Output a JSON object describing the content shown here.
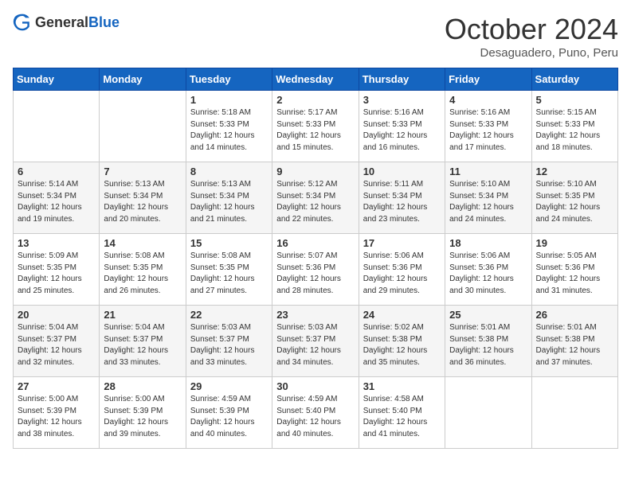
{
  "header": {
    "logo_general": "General",
    "logo_blue": "Blue",
    "month_title": "October 2024",
    "location": "Desaguadero, Puno, Peru"
  },
  "days_of_week": [
    "Sunday",
    "Monday",
    "Tuesday",
    "Wednesday",
    "Thursday",
    "Friday",
    "Saturday"
  ],
  "weeks": [
    [
      {
        "day": "",
        "info": ""
      },
      {
        "day": "",
        "info": ""
      },
      {
        "day": "1",
        "info": "Sunrise: 5:18 AM\nSunset: 5:33 PM\nDaylight: 12 hours\nand 14 minutes."
      },
      {
        "day": "2",
        "info": "Sunrise: 5:17 AM\nSunset: 5:33 PM\nDaylight: 12 hours\nand 15 minutes."
      },
      {
        "day": "3",
        "info": "Sunrise: 5:16 AM\nSunset: 5:33 PM\nDaylight: 12 hours\nand 16 minutes."
      },
      {
        "day": "4",
        "info": "Sunrise: 5:16 AM\nSunset: 5:33 PM\nDaylight: 12 hours\nand 17 minutes."
      },
      {
        "day": "5",
        "info": "Sunrise: 5:15 AM\nSunset: 5:33 PM\nDaylight: 12 hours\nand 18 minutes."
      }
    ],
    [
      {
        "day": "6",
        "info": "Sunrise: 5:14 AM\nSunset: 5:34 PM\nDaylight: 12 hours\nand 19 minutes."
      },
      {
        "day": "7",
        "info": "Sunrise: 5:13 AM\nSunset: 5:34 PM\nDaylight: 12 hours\nand 20 minutes."
      },
      {
        "day": "8",
        "info": "Sunrise: 5:13 AM\nSunset: 5:34 PM\nDaylight: 12 hours\nand 21 minutes."
      },
      {
        "day": "9",
        "info": "Sunrise: 5:12 AM\nSunset: 5:34 PM\nDaylight: 12 hours\nand 22 minutes."
      },
      {
        "day": "10",
        "info": "Sunrise: 5:11 AM\nSunset: 5:34 PM\nDaylight: 12 hours\nand 23 minutes."
      },
      {
        "day": "11",
        "info": "Sunrise: 5:10 AM\nSunset: 5:34 PM\nDaylight: 12 hours\nand 24 minutes."
      },
      {
        "day": "12",
        "info": "Sunrise: 5:10 AM\nSunset: 5:35 PM\nDaylight: 12 hours\nand 24 minutes."
      }
    ],
    [
      {
        "day": "13",
        "info": "Sunrise: 5:09 AM\nSunset: 5:35 PM\nDaylight: 12 hours\nand 25 minutes."
      },
      {
        "day": "14",
        "info": "Sunrise: 5:08 AM\nSunset: 5:35 PM\nDaylight: 12 hours\nand 26 minutes."
      },
      {
        "day": "15",
        "info": "Sunrise: 5:08 AM\nSunset: 5:35 PM\nDaylight: 12 hours\nand 27 minutes."
      },
      {
        "day": "16",
        "info": "Sunrise: 5:07 AM\nSunset: 5:36 PM\nDaylight: 12 hours\nand 28 minutes."
      },
      {
        "day": "17",
        "info": "Sunrise: 5:06 AM\nSunset: 5:36 PM\nDaylight: 12 hours\nand 29 minutes."
      },
      {
        "day": "18",
        "info": "Sunrise: 5:06 AM\nSunset: 5:36 PM\nDaylight: 12 hours\nand 30 minutes."
      },
      {
        "day": "19",
        "info": "Sunrise: 5:05 AM\nSunset: 5:36 PM\nDaylight: 12 hours\nand 31 minutes."
      }
    ],
    [
      {
        "day": "20",
        "info": "Sunrise: 5:04 AM\nSunset: 5:37 PM\nDaylight: 12 hours\nand 32 minutes."
      },
      {
        "day": "21",
        "info": "Sunrise: 5:04 AM\nSunset: 5:37 PM\nDaylight: 12 hours\nand 33 minutes."
      },
      {
        "day": "22",
        "info": "Sunrise: 5:03 AM\nSunset: 5:37 PM\nDaylight: 12 hours\nand 33 minutes."
      },
      {
        "day": "23",
        "info": "Sunrise: 5:03 AM\nSunset: 5:37 PM\nDaylight: 12 hours\nand 34 minutes."
      },
      {
        "day": "24",
        "info": "Sunrise: 5:02 AM\nSunset: 5:38 PM\nDaylight: 12 hours\nand 35 minutes."
      },
      {
        "day": "25",
        "info": "Sunrise: 5:01 AM\nSunset: 5:38 PM\nDaylight: 12 hours\nand 36 minutes."
      },
      {
        "day": "26",
        "info": "Sunrise: 5:01 AM\nSunset: 5:38 PM\nDaylight: 12 hours\nand 37 minutes."
      }
    ],
    [
      {
        "day": "27",
        "info": "Sunrise: 5:00 AM\nSunset: 5:39 PM\nDaylight: 12 hours\nand 38 minutes."
      },
      {
        "day": "28",
        "info": "Sunrise: 5:00 AM\nSunset: 5:39 PM\nDaylight: 12 hours\nand 39 minutes."
      },
      {
        "day": "29",
        "info": "Sunrise: 4:59 AM\nSunset: 5:39 PM\nDaylight: 12 hours\nand 40 minutes."
      },
      {
        "day": "30",
        "info": "Sunrise: 4:59 AM\nSunset: 5:40 PM\nDaylight: 12 hours\nand 40 minutes."
      },
      {
        "day": "31",
        "info": "Sunrise: 4:58 AM\nSunset: 5:40 PM\nDaylight: 12 hours\nand 41 minutes."
      },
      {
        "day": "",
        "info": ""
      },
      {
        "day": "",
        "info": ""
      }
    ]
  ]
}
